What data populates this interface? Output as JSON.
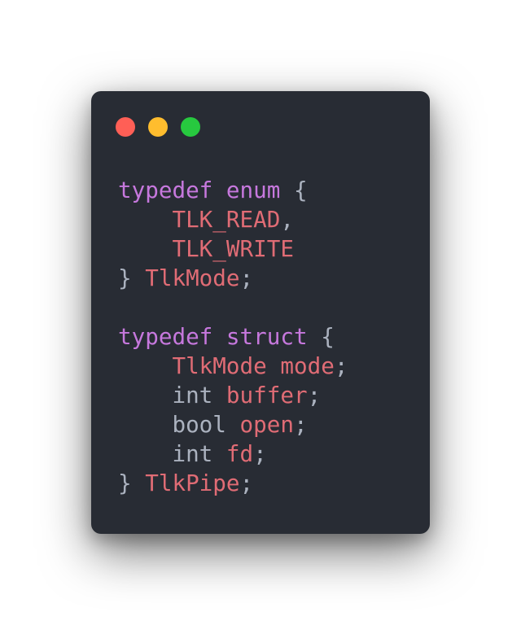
{
  "colors": {
    "page_background": "#ffffff",
    "editor_background": "#282c34",
    "close_dot": "#ff5f56",
    "minimize_dot": "#ffbd2e",
    "maximize_dot": "#27c93f",
    "keyword": "#c678dd",
    "identifier": "#e06c75",
    "plain": "#abb2bf"
  },
  "window_controls": [
    {
      "name": "close-dot",
      "color": "#ff5f56"
    },
    {
      "name": "minimize-dot",
      "color": "#ffbd2e"
    },
    {
      "name": "maximize-dot",
      "color": "#27c93f"
    }
  ],
  "code_lines": [
    [
      {
        "t": "typedef",
        "c": "keyword"
      },
      {
        "t": " ",
        "c": "plain"
      },
      {
        "t": "enum",
        "c": "keyword"
      },
      {
        "t": " {",
        "c": "plain"
      }
    ],
    [
      {
        "t": "    ",
        "c": "plain"
      },
      {
        "t": "TLK_READ",
        "c": "identifier"
      },
      {
        "t": ",",
        "c": "plain"
      }
    ],
    [
      {
        "t": "    ",
        "c": "plain"
      },
      {
        "t": "TLK_WRITE",
        "c": "identifier"
      }
    ],
    [
      {
        "t": "} ",
        "c": "plain"
      },
      {
        "t": "TlkMode",
        "c": "identifier"
      },
      {
        "t": ";",
        "c": "plain"
      }
    ],
    [],
    [
      {
        "t": "typedef",
        "c": "keyword"
      },
      {
        "t": " ",
        "c": "plain"
      },
      {
        "t": "struct",
        "c": "keyword"
      },
      {
        "t": " {",
        "c": "plain"
      }
    ],
    [
      {
        "t": "    ",
        "c": "plain"
      },
      {
        "t": "TlkMode",
        "c": "identifier"
      },
      {
        "t": " ",
        "c": "plain"
      },
      {
        "t": "mode",
        "c": "identifier"
      },
      {
        "t": ";",
        "c": "plain"
      }
    ],
    [
      {
        "t": "    int ",
        "c": "plain"
      },
      {
        "t": "buffer",
        "c": "identifier"
      },
      {
        "t": ";",
        "c": "plain"
      }
    ],
    [
      {
        "t": "    bool ",
        "c": "plain"
      },
      {
        "t": "open",
        "c": "identifier"
      },
      {
        "t": ";",
        "c": "plain"
      }
    ],
    [
      {
        "t": "    int ",
        "c": "plain"
      },
      {
        "t": "fd",
        "c": "identifier"
      },
      {
        "t": ";",
        "c": "plain"
      }
    ],
    [
      {
        "t": "} ",
        "c": "plain"
      },
      {
        "t": "TlkPipe",
        "c": "identifier"
      },
      {
        "t": ";",
        "c": "plain"
      }
    ]
  ]
}
